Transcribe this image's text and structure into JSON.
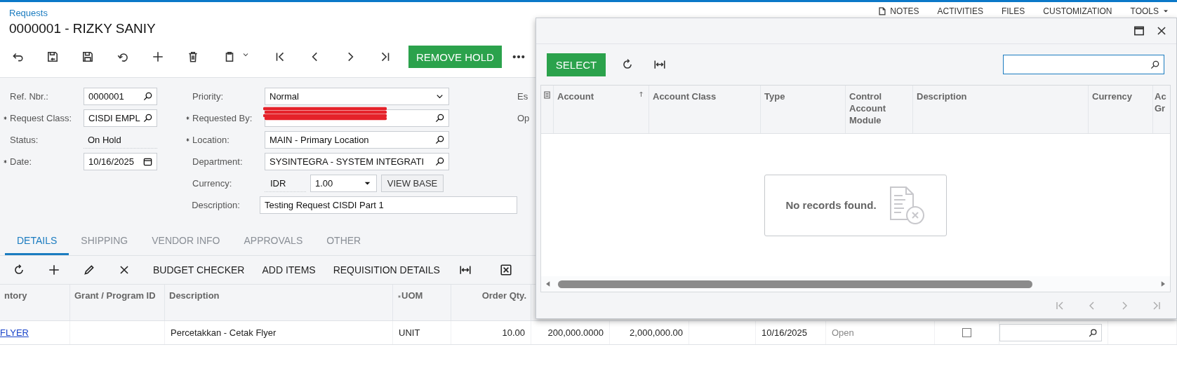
{
  "header": {
    "breadcrumb": "Requests",
    "title": "0000001 - RIZKY SANIY",
    "links": [
      {
        "label": "NOTES",
        "kind": "notes"
      },
      {
        "label": "ACTIVITIES",
        "kind": "link"
      },
      {
        "label": "FILES",
        "kind": "link"
      },
      {
        "label": "CUSTOMIZATION",
        "kind": "link"
      },
      {
        "label": "TOOLS",
        "kind": "menu"
      }
    ]
  },
  "toolbar": {
    "action": "REMOVE HOLD"
  },
  "form": {
    "left": [
      {
        "label": "Ref. Nbr.:",
        "required": false,
        "kind": "lookup",
        "value": "0000001"
      },
      {
        "label": "Request Class:",
        "required": true,
        "kind": "lookup",
        "value": "CISDI EMPL"
      },
      {
        "label": "Status:",
        "required": false,
        "kind": "static",
        "value": "On Hold"
      },
      {
        "label": "Date:",
        "required": true,
        "kind": "date",
        "value": "10/16/2025"
      }
    ],
    "right": [
      {
        "label": "Priority:",
        "required": false,
        "kind": "select",
        "value": "Normal"
      },
      {
        "label": "Requested By:",
        "required": true,
        "kind": "redacted"
      },
      {
        "label": "Location:",
        "required": true,
        "kind": "lookup",
        "value": "MAIN - Primary Location"
      },
      {
        "label": "Department:",
        "required": false,
        "kind": "lookup",
        "value": "SYSINTEGRA - SYSTEM INTEGRATI"
      },
      {
        "label": "Currency:",
        "required": false,
        "kind": "currency",
        "value": "IDR",
        "rate": "1.00",
        "button": "VIEW BASE"
      },
      {
        "label": "Description:",
        "required": false,
        "kind": "text",
        "value": "Testing Request CISDI Part 1"
      }
    ],
    "cut_labels": [
      "Es",
      "Op"
    ]
  },
  "tabs": [
    {
      "label": "DETAILS",
      "selected": true
    },
    {
      "label": "SHIPPING",
      "selected": false
    },
    {
      "label": "VENDOR INFO",
      "selected": false
    },
    {
      "label": "APPROVALS",
      "selected": false
    },
    {
      "label": "OTHER",
      "selected": false
    }
  ],
  "grid_toolbar": {
    "actions": [
      "BUDGET CHECKER",
      "ADD ITEMS",
      "REQUISITION DETAILS"
    ]
  },
  "grid": {
    "columns": [
      {
        "label": "ntory",
        "required": false,
        "kind": "text"
      },
      {
        "label": "Grant / Program ID",
        "required": false,
        "kind": "text"
      },
      {
        "label": "Description",
        "required": false,
        "kind": "text"
      },
      {
        "label": "UOM",
        "required": true,
        "kind": "text"
      },
      {
        "label": "Order Qty.",
        "required": false,
        "kind": "number"
      }
    ],
    "rows": [
      {
        "cells": [
          {
            "kind": "link",
            "value": "FLYER"
          },
          {
            "kind": "empty"
          },
          {
            "kind": "text",
            "value": "Percetakkan - Cetak Flyer"
          },
          {
            "kind": "text",
            "value": "UNIT"
          },
          {
            "kind": "number",
            "value": "10.00"
          },
          {
            "kind": "number",
            "value": "200,000.0000"
          },
          {
            "kind": "number",
            "value": "2,000,000.00"
          },
          {
            "kind": "empty"
          },
          {
            "kind": "text",
            "value": "10/16/2025"
          },
          {
            "kind": "status",
            "value": "Open"
          },
          {
            "kind": "checkbox",
            "checked": false
          },
          {
            "kind": "lookup"
          },
          {
            "kind": "empty"
          }
        ]
      }
    ]
  },
  "dialog": {
    "select": "SELECT",
    "columns": [
      {
        "label": "Account",
        "sorted": true
      },
      {
        "label": "Account Class",
        "sorted": false
      },
      {
        "label": "Type",
        "sorted": false
      },
      {
        "label": "Control Account Module",
        "sorted": false
      },
      {
        "label": "Description",
        "sorted": false
      },
      {
        "label": "Currency",
        "sorted": false
      },
      {
        "label": "Ac Gr",
        "sorted": false
      }
    ],
    "empty_message": "No records found."
  }
}
